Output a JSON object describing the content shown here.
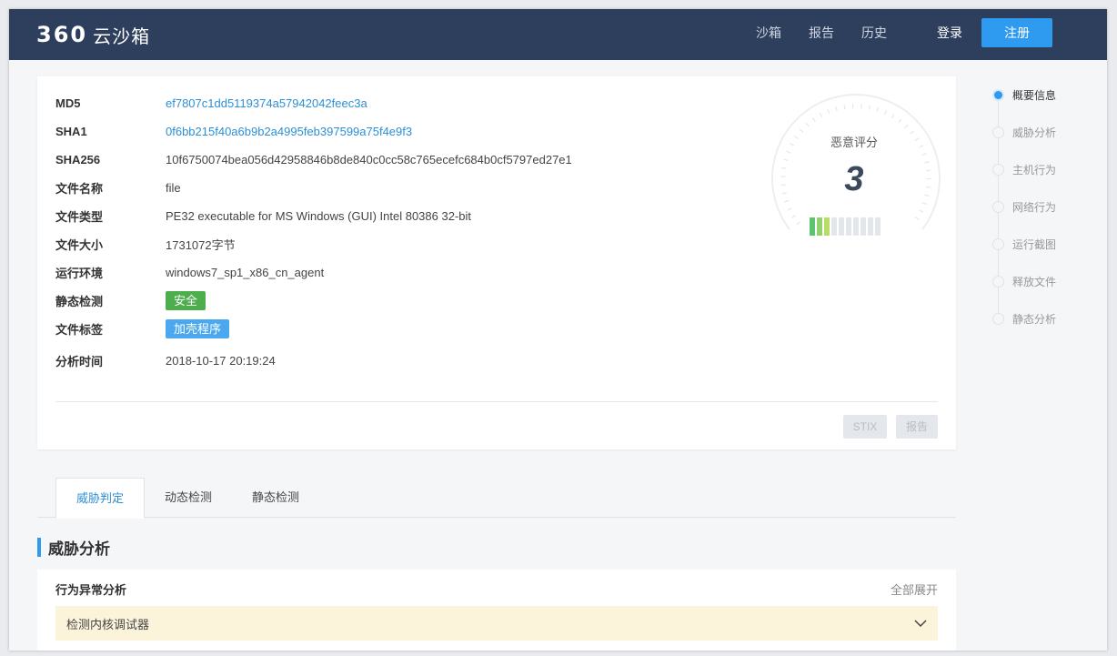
{
  "header": {
    "logo_num": "360",
    "logo_text": "云沙箱",
    "nav": [
      "沙箱",
      "报告",
      "历史"
    ],
    "login": "登录",
    "register": "注册"
  },
  "summary": {
    "rows": [
      {
        "key": "MD5",
        "value": "ef7807c1dd5119374a57942042feec3a"
      },
      {
        "key": "SHA1",
        "value": "0f6bb215f40a6b9b2a4995feb397599a75f4e9f3"
      },
      {
        "key": "SHA256",
        "value": "10f6750074bea056d42958846b8de840c0cc58c765ecefc684b0cf5797ed27e1"
      },
      {
        "key": "文件名称",
        "value": "file"
      },
      {
        "key": "文件类型",
        "value": "PE32 executable for MS Windows (GUI) Intel 80386 32-bit"
      },
      {
        "key": "文件大小",
        "value": "1731072字节"
      },
      {
        "key": "运行环境",
        "value": "windows7_sp1_x86_cn_agent"
      },
      {
        "key": "静态检测",
        "value": "安全"
      },
      {
        "key": "文件标签",
        "value": "加壳程序"
      },
      {
        "key": "分析时间",
        "value": "2018-10-17 20:19:24"
      }
    ],
    "buttons": {
      "stix": "STIX",
      "report": "报告"
    }
  },
  "gauge": {
    "label": "恶意评分",
    "score": "3",
    "level_filled": 3,
    "level_total": 10,
    "colors": {
      "filled": [
        "#5cc36f",
        "#8fd36a",
        "#b9dc66"
      ],
      "empty": "#e3e6ea"
    }
  },
  "anchor_nav": {
    "items": [
      "概要信息",
      "威胁分析",
      "主机行为",
      "网络行为",
      "运行截图",
      "释放文件",
      "静态分析"
    ],
    "active": 0
  },
  "tabs": {
    "items": [
      "威胁判定",
      "动态检测",
      "静态检测"
    ],
    "active": 0
  },
  "threat": {
    "section_title": "威胁分析",
    "panel_title": "行为异常分析",
    "expand_all": "全部展开",
    "first_item": "检测内核调试器"
  },
  "colors": {
    "header_bg": "#2e3f5e",
    "accent": "#2f9bf0",
    "link": "#2d8fd5",
    "safe_tag": "#4cae4c",
    "packer_tag": "#4ba8ef",
    "warning_row": "#fcf3db"
  }
}
